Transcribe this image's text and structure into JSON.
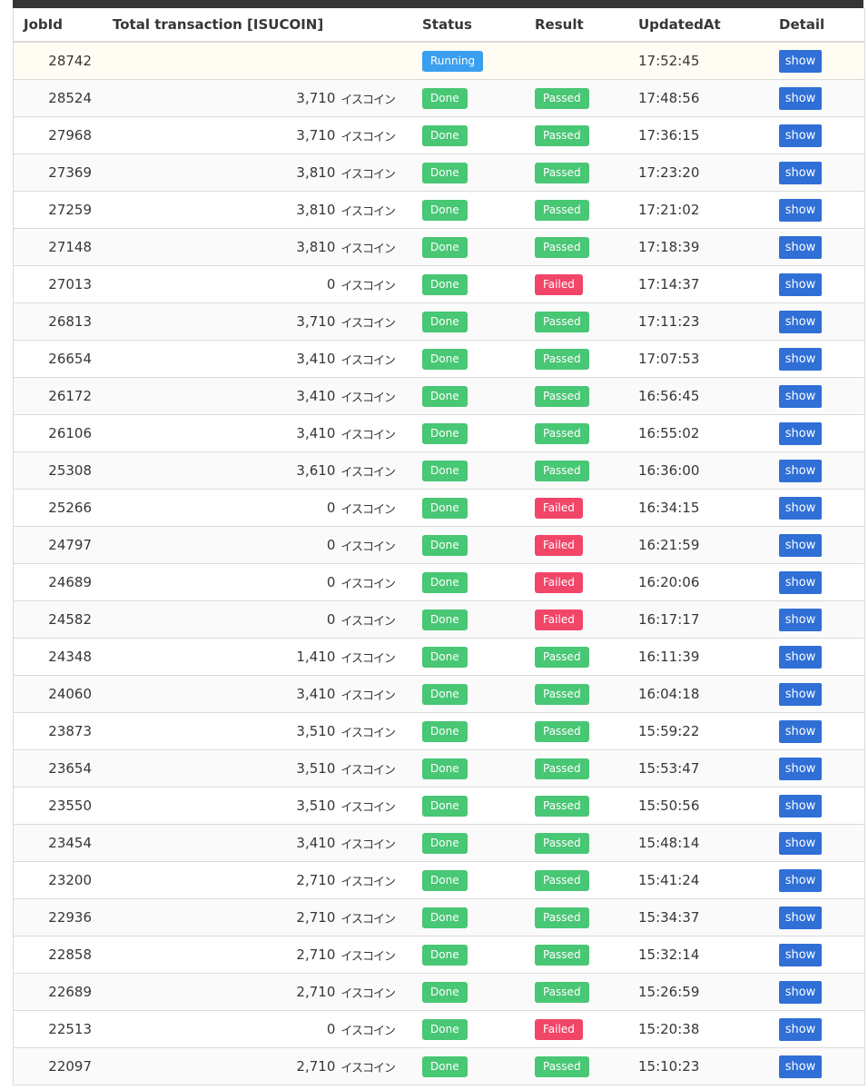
{
  "table": {
    "headers": {
      "job_id": "JobId",
      "total": "Total transaction [ISUCOIN]",
      "status": "Status",
      "result": "Result",
      "updated_at": "UpdatedAt",
      "detail": "Detail"
    },
    "unit": "イスコイン",
    "rows": [
      {
        "job_id": "28742",
        "total": "",
        "status": "Running",
        "result": "",
        "updated_at": "17:52:45",
        "detail": "show"
      },
      {
        "job_id": "28524",
        "total": "3,710",
        "status": "Done",
        "result": "Passed",
        "updated_at": "17:48:56",
        "detail": "show"
      },
      {
        "job_id": "27968",
        "total": "3,710",
        "status": "Done",
        "result": "Passed",
        "updated_at": "17:36:15",
        "detail": "show"
      },
      {
        "job_id": "27369",
        "total": "3,810",
        "status": "Done",
        "result": "Passed",
        "updated_at": "17:23:20",
        "detail": "show"
      },
      {
        "job_id": "27259",
        "total": "3,810",
        "status": "Done",
        "result": "Passed",
        "updated_at": "17:21:02",
        "detail": "show"
      },
      {
        "job_id": "27148",
        "total": "3,810",
        "status": "Done",
        "result": "Passed",
        "updated_at": "17:18:39",
        "detail": "show"
      },
      {
        "job_id": "27013",
        "total": "0",
        "status": "Done",
        "result": "Failed",
        "updated_at": "17:14:37",
        "detail": "show"
      },
      {
        "job_id": "26813",
        "total": "3,710",
        "status": "Done",
        "result": "Passed",
        "updated_at": "17:11:23",
        "detail": "show"
      },
      {
        "job_id": "26654",
        "total": "3,410",
        "status": "Done",
        "result": "Passed",
        "updated_at": "17:07:53",
        "detail": "show"
      },
      {
        "job_id": "26172",
        "total": "3,410",
        "status": "Done",
        "result": "Passed",
        "updated_at": "16:56:45",
        "detail": "show"
      },
      {
        "job_id": "26106",
        "total": "3,410",
        "status": "Done",
        "result": "Passed",
        "updated_at": "16:55:02",
        "detail": "show"
      },
      {
        "job_id": "25308",
        "total": "3,610",
        "status": "Done",
        "result": "Passed",
        "updated_at": "16:36:00",
        "detail": "show"
      },
      {
        "job_id": "25266",
        "total": "0",
        "status": "Done",
        "result": "Failed",
        "updated_at": "16:34:15",
        "detail": "show"
      },
      {
        "job_id": "24797",
        "total": "0",
        "status": "Done",
        "result": "Failed",
        "updated_at": "16:21:59",
        "detail": "show"
      },
      {
        "job_id": "24689",
        "total": "0",
        "status": "Done",
        "result": "Failed",
        "updated_at": "16:20:06",
        "detail": "show"
      },
      {
        "job_id": "24582",
        "total": "0",
        "status": "Done",
        "result": "Failed",
        "updated_at": "16:17:17",
        "detail": "show"
      },
      {
        "job_id": "24348",
        "total": "1,410",
        "status": "Done",
        "result": "Passed",
        "updated_at": "16:11:39",
        "detail": "show"
      },
      {
        "job_id": "24060",
        "total": "3,410",
        "status": "Done",
        "result": "Passed",
        "updated_at": "16:04:18",
        "detail": "show"
      },
      {
        "job_id": "23873",
        "total": "3,510",
        "status": "Done",
        "result": "Passed",
        "updated_at": "15:59:22",
        "detail": "show"
      },
      {
        "job_id": "23654",
        "total": "3,510",
        "status": "Done",
        "result": "Passed",
        "updated_at": "15:53:47",
        "detail": "show"
      },
      {
        "job_id": "23550",
        "total": "3,510",
        "status": "Done",
        "result": "Passed",
        "updated_at": "15:50:56",
        "detail": "show"
      },
      {
        "job_id": "23454",
        "total": "3,410",
        "status": "Done",
        "result": "Passed",
        "updated_at": "15:48:14",
        "detail": "show"
      },
      {
        "job_id": "23200",
        "total": "2,710",
        "status": "Done",
        "result": "Passed",
        "updated_at": "15:41:24",
        "detail": "show"
      },
      {
        "job_id": "22936",
        "total": "2,710",
        "status": "Done",
        "result": "Passed",
        "updated_at": "15:34:37",
        "detail": "show"
      },
      {
        "job_id": "22858",
        "total": "2,710",
        "status": "Done",
        "result": "Passed",
        "updated_at": "15:32:14",
        "detail": "show"
      },
      {
        "job_id": "22689",
        "total": "2,710",
        "status": "Done",
        "result": "Passed",
        "updated_at": "15:26:59",
        "detail": "show"
      },
      {
        "job_id": "22513",
        "total": "0",
        "status": "Done",
        "result": "Failed",
        "updated_at": "15:20:38",
        "detail": "show"
      },
      {
        "job_id": "22097",
        "total": "2,710",
        "status": "Done",
        "result": "Passed",
        "updated_at": "15:10:23",
        "detail": "show"
      }
    ]
  },
  "colors": {
    "running": "#3a9ff0",
    "done": "#48c774",
    "passed": "#48c774",
    "failed": "#f14668",
    "show_button": "#2f6fd6",
    "top_bar": "#363636"
  }
}
